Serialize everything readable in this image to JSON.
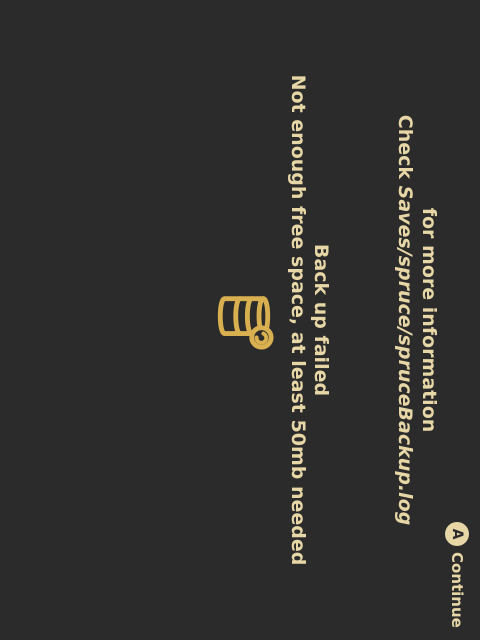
{
  "dialog": {
    "icon": "database-sync-icon",
    "title": "Back up failed",
    "message": "Not enough free space, at least 50mb needed",
    "hint_prefix": "Check ",
    "hint_path": "Saves/spruce/spruceBackup.log",
    "hint_suffix": "for more information"
  },
  "footer": {
    "button_glyph": "A",
    "button_label": "Continue"
  },
  "colors": {
    "background": "#2b2b2b",
    "accent": "#e7d7a6",
    "icon": "#d9b04f"
  }
}
